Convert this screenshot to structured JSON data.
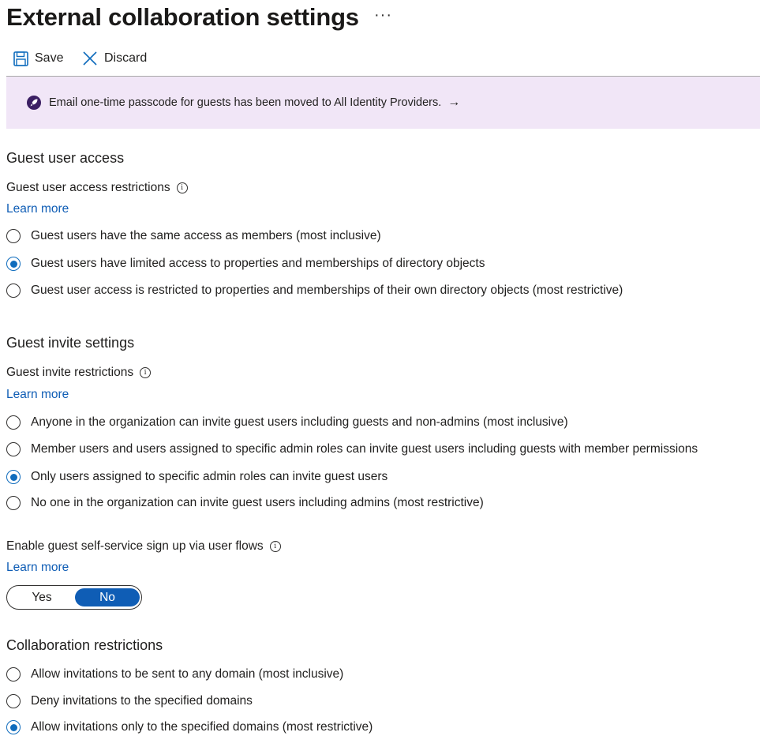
{
  "page": {
    "title": "External collaboration settings",
    "more_label": "···"
  },
  "toolbar": {
    "save_label": "Save",
    "discard_label": "Discard"
  },
  "banner": {
    "text": "Email one-time passcode for guests has been moved to All Identity Providers.",
    "arrow": "→"
  },
  "guest_access": {
    "section_title": "Guest user access",
    "field_label": "Guest user access restrictions",
    "learn_more": "Learn more",
    "options": [
      {
        "label": "Guest users have the same access as members (most inclusive)",
        "selected": false
      },
      {
        "label": "Guest users have limited access to properties and memberships of directory objects",
        "selected": true
      },
      {
        "label": "Guest user access is restricted to properties and memberships of their own directory objects (most restrictive)",
        "selected": false
      }
    ]
  },
  "guest_invite": {
    "section_title": "Guest invite settings",
    "field_label": "Guest invite restrictions",
    "learn_more": "Learn more",
    "options": [
      {
        "label": "Anyone in the organization can invite guest users including guests and non-admins (most inclusive)",
        "selected": false
      },
      {
        "label": "Member users and users assigned to specific admin roles can invite guest users including guests with member permissions",
        "selected": false
      },
      {
        "label": "Only users assigned to specific admin roles can invite guest users",
        "selected": true
      },
      {
        "label": "No one in the organization can invite guest users including admins (most restrictive)",
        "selected": false
      }
    ]
  },
  "self_service": {
    "field_label": "Enable guest self-service sign up via user flows",
    "learn_more": "Learn more",
    "toggle": {
      "yes_label": "Yes",
      "no_label": "No",
      "selected": "No"
    }
  },
  "collaboration": {
    "section_title": "Collaboration restrictions",
    "options": [
      {
        "label": "Allow invitations to be sent to any domain (most inclusive)",
        "selected": false
      },
      {
        "label": "Deny invitations to the specified domains",
        "selected": false
      },
      {
        "label": "Allow invitations only to the specified domains (most restrictive)",
        "selected": true
      }
    ]
  },
  "colors": {
    "accent": "#0f6cbd",
    "link": "#0f5db5",
    "banner_bg": "#f1e6f7",
    "banner_icon": "#3b1f63"
  },
  "icons": {
    "save": "save-icon",
    "discard": "close-icon",
    "banner": "rocket-icon",
    "info": "info-icon"
  }
}
